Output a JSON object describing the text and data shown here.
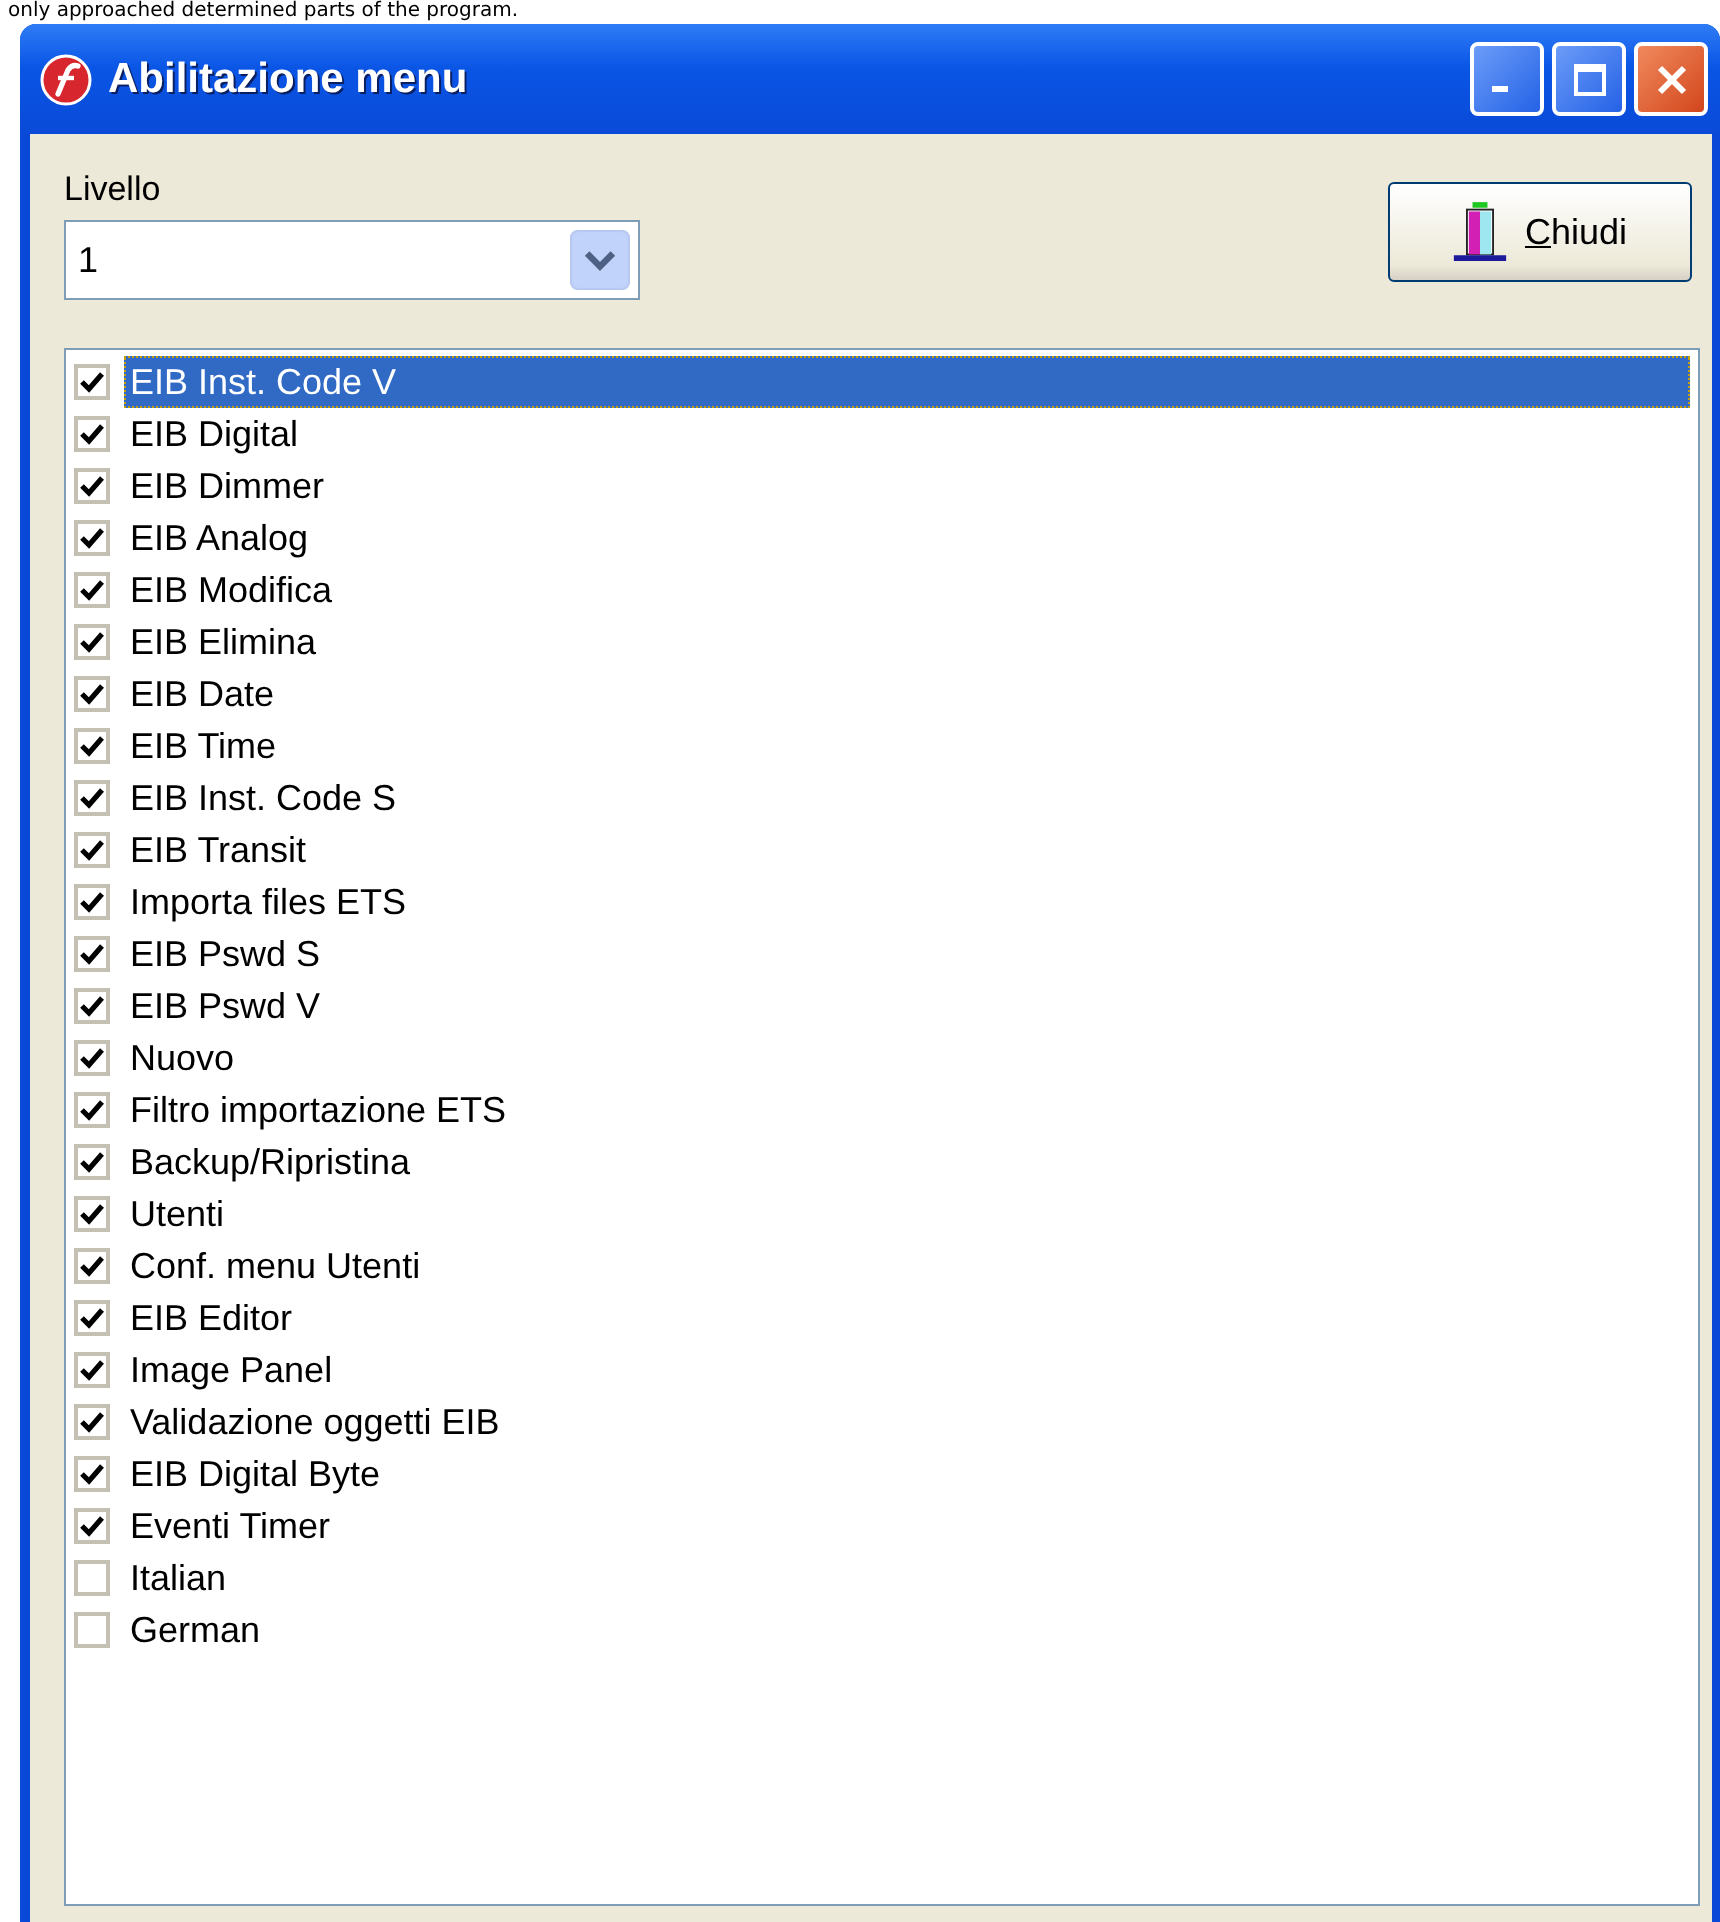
{
  "caption": "only approached determined parts of the program.",
  "window": {
    "title": "Abilitazione menu"
  },
  "level_field": {
    "label": "Livello",
    "value": "1"
  },
  "close_button": {
    "label": "Chiudi"
  },
  "items": [
    {
      "label": "EIB Inst. Code V",
      "checked": true,
      "selected": true
    },
    {
      "label": "EIB Digital",
      "checked": true,
      "selected": false
    },
    {
      "label": "EIB Dimmer",
      "checked": true,
      "selected": false
    },
    {
      "label": "EIB Analog",
      "checked": true,
      "selected": false
    },
    {
      "label": "EIB Modifica",
      "checked": true,
      "selected": false
    },
    {
      "label": "EIB Elimina",
      "checked": true,
      "selected": false
    },
    {
      "label": "EIB Date",
      "checked": true,
      "selected": false
    },
    {
      "label": "EIB Time",
      "checked": true,
      "selected": false
    },
    {
      "label": "EIB Inst. Code S",
      "checked": true,
      "selected": false
    },
    {
      "label": "EIB Transit",
      "checked": true,
      "selected": false
    },
    {
      "label": "Importa files ETS",
      "checked": true,
      "selected": false
    },
    {
      "label": "EIB Pswd S",
      "checked": true,
      "selected": false
    },
    {
      "label": "EIB Pswd V",
      "checked": true,
      "selected": false
    },
    {
      "label": "Nuovo",
      "checked": true,
      "selected": false
    },
    {
      "label": "Filtro importazione ETS",
      "checked": true,
      "selected": false
    },
    {
      "label": "Backup/Ripristina",
      "checked": true,
      "selected": false
    },
    {
      "label": "Utenti",
      "checked": true,
      "selected": false
    },
    {
      "label": "Conf. menu Utenti",
      "checked": true,
      "selected": false
    },
    {
      "label": "EIB Editor",
      "checked": true,
      "selected": false
    },
    {
      "label": "Image Panel",
      "checked": true,
      "selected": false
    },
    {
      "label": "Validazione oggetti EIB",
      "checked": true,
      "selected": false
    },
    {
      "label": "EIB Digital Byte",
      "checked": true,
      "selected": false
    },
    {
      "label": "Eventi Timer",
      "checked": true,
      "selected": false
    },
    {
      "label": "Italian",
      "checked": false,
      "selected": false
    },
    {
      "label": "German",
      "checked": false,
      "selected": false
    }
  ]
}
